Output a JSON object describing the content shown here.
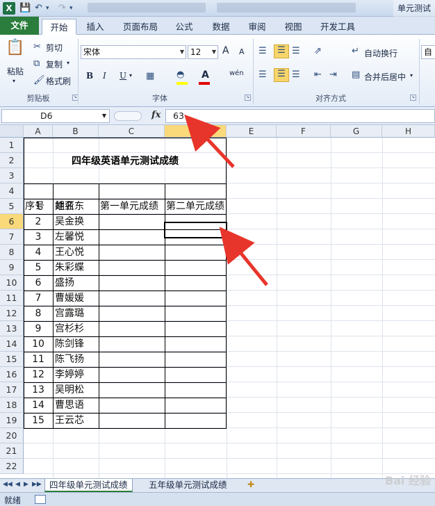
{
  "window": {
    "title": "单元测试"
  },
  "ribbon_tabs": [
    "文件",
    "开始",
    "插入",
    "页面布局",
    "公式",
    "数据",
    "审阅",
    "视图",
    "开发工具"
  ],
  "clipboard": {
    "paste": "粘贴",
    "cut": "剪切",
    "copy": "复制",
    "format_painter": "格式刷",
    "group": "剪贴板"
  },
  "font": {
    "name": "宋体",
    "size": "12",
    "bold": "B",
    "italic": "I",
    "underline": "U",
    "grow": "A",
    "shrink": "A",
    "wen": "wén",
    "group": "字体"
  },
  "alignment": {
    "wrap": "自动换行",
    "merge": "合并后居中",
    "group": "对齐方式"
  },
  "number": {
    "format_value": "自"
  },
  "formula_bar": {
    "name_box": "D6",
    "fx": "fx",
    "content": "63"
  },
  "columns": [
    "A",
    "B",
    "C",
    "D",
    "E",
    "F",
    "G",
    "H"
  ],
  "rows": [
    "1",
    "2",
    "3",
    "4",
    "5",
    "6",
    "7",
    "8",
    "9",
    "10",
    "11",
    "12",
    "13",
    "14",
    "15",
    "16",
    "17",
    "18",
    "19",
    "20",
    "21",
    "22"
  ],
  "sheet": {
    "title": "四年级英语单元测试成绩",
    "headers": [
      "序号",
      "姓名",
      "第一单元成绩",
      "第二单元成绩"
    ],
    "students": [
      {
        "no": "1",
        "name": "胡亚东"
      },
      {
        "no": "2",
        "name": "吴金换"
      },
      {
        "no": "3",
        "name": "左馨悦"
      },
      {
        "no": "4",
        "name": "王心悦"
      },
      {
        "no": "5",
        "name": "朱彩蝶"
      },
      {
        "no": "6",
        "name": "盛扬"
      },
      {
        "no": "7",
        "name": "曹媛媛"
      },
      {
        "no": "8",
        "name": "宫露璐"
      },
      {
        "no": "9",
        "name": "宫杉杉"
      },
      {
        "no": "10",
        "name": "陈剑锋"
      },
      {
        "no": "11",
        "name": "陈飞扬"
      },
      {
        "no": "12",
        "name": "李婷婷"
      },
      {
        "no": "13",
        "name": "吴明松"
      },
      {
        "no": "14",
        "name": "曹思语"
      },
      {
        "no": "15",
        "name": "王云芯"
      }
    ]
  },
  "sheet_tabs": [
    "四年级单元测试成绩",
    "五年级单元测试成绩"
  ],
  "status": {
    "ready": "就绪"
  },
  "watermark": "Bai 经验",
  "colors": {
    "file_tab": "#2a7d3c",
    "selected_header": "#f9d97a",
    "arrow": "#e8352b"
  }
}
